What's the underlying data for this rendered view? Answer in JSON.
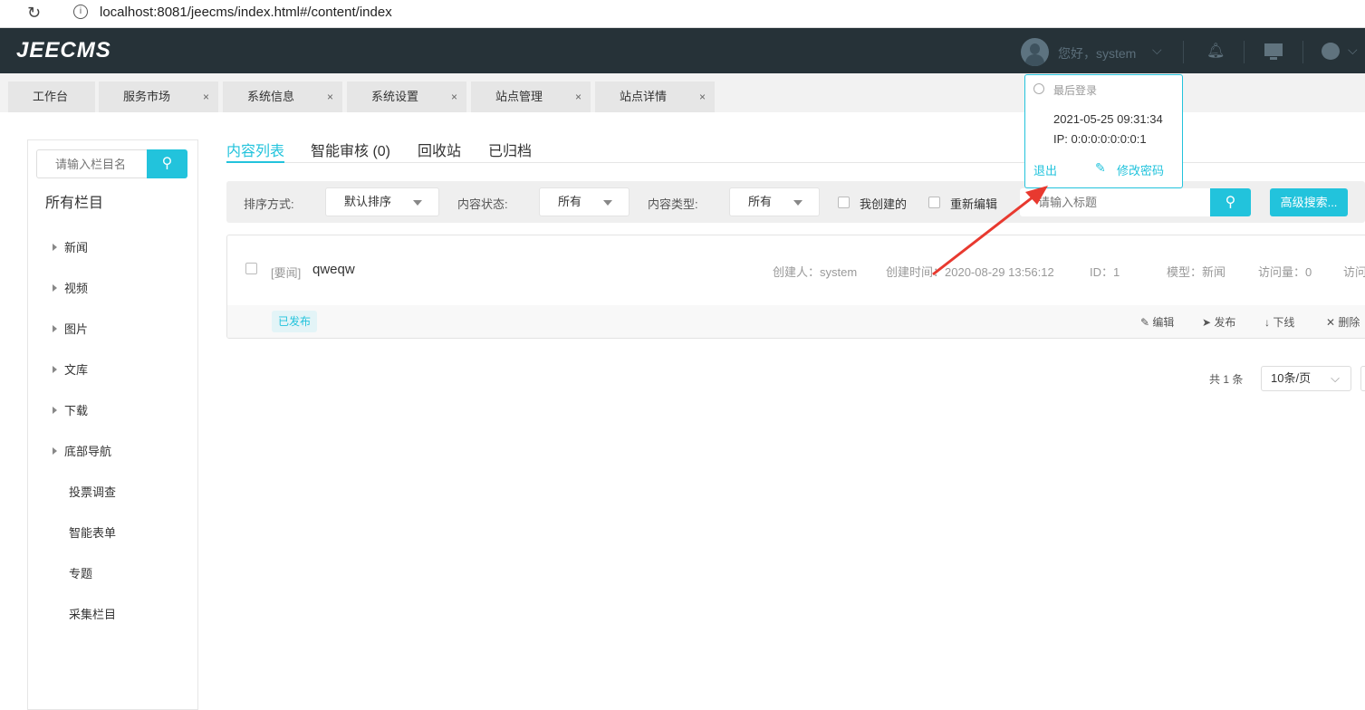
{
  "browser": {
    "url": "localhost:8081/jeecms/index.html#/content/index"
  },
  "header": {
    "logo": "JEECMS",
    "greeting": "您好，system"
  },
  "tabs": [
    {
      "label": "工作台",
      "closable": false
    },
    {
      "label": "服务市场",
      "closable": true
    },
    {
      "label": "系统信息",
      "closable": true
    },
    {
      "label": "系统设置",
      "closable": true
    },
    {
      "label": "站点管理",
      "closable": true
    },
    {
      "label": "站点详情",
      "closable": true
    }
  ],
  "tab_close": "×",
  "sidebar": {
    "search_placeholder": "请输入栏目名",
    "title": "所有栏目",
    "items": [
      {
        "label": "新闻",
        "expandable": true
      },
      {
        "label": "视频",
        "expandable": true
      },
      {
        "label": "图片",
        "expandable": true
      },
      {
        "label": "文库",
        "expandable": true
      },
      {
        "label": "下载",
        "expandable": true
      },
      {
        "label": "底部导航",
        "expandable": true
      },
      {
        "label": "投票调查",
        "expandable": false
      },
      {
        "label": "智能表单",
        "expandable": false
      },
      {
        "label": "专题",
        "expandable": false
      },
      {
        "label": "采集栏目",
        "expandable": false
      }
    ]
  },
  "main_tabs": [
    {
      "label": "内容列表",
      "active": true
    },
    {
      "label": "智能审核 (0)"
    },
    {
      "label": "回收站"
    },
    {
      "label": "已归档"
    }
  ],
  "filters": {
    "sort_label": "排序方式:",
    "sort_value": "默认排序",
    "status_label": "内容状态:",
    "status_value": "所有",
    "type_label": "内容类型:",
    "type_value": "所有",
    "mine_label": "我创建的",
    "reedit_label": "重新编辑",
    "title_placeholder": "请输入标题",
    "advanced": "高级搜索..."
  },
  "item": {
    "tag": "[要闻]",
    "title": "qweqw",
    "creator": "创建人：system",
    "created": "创建时间：2020-08-29 13:56:12",
    "id": "ID：1",
    "model": "模型：新闻",
    "views": "访问量：0",
    "more": "访问",
    "status": "已发布",
    "actions": {
      "edit": "编辑",
      "publish": "发布",
      "offline": "下线",
      "delete": "删除"
    }
  },
  "pagination": {
    "total": "共 1 条",
    "page_size": "10条/页"
  },
  "popup": {
    "title": "最后登录",
    "time": "2021-05-25 09:31:34",
    "ip": "IP: 0:0:0:0:0:0:0:1",
    "logout": "退出",
    "change_password": "修改密码"
  },
  "colors": {
    "accent": "#22c3dc",
    "header": "#263238",
    "arrow": "#e8392f"
  }
}
